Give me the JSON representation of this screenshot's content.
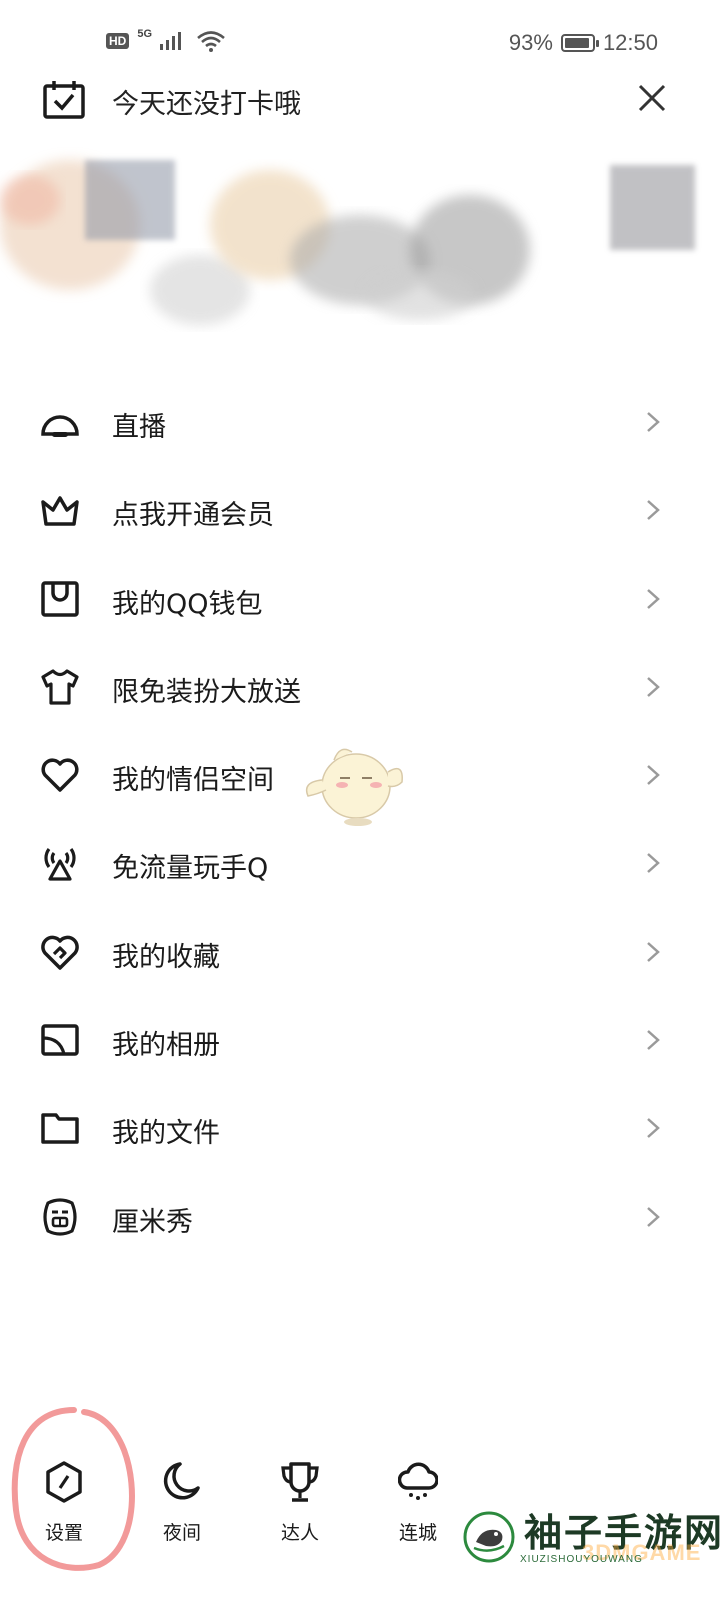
{
  "status_bar": {
    "hd": "HD",
    "network": "5G",
    "battery_text": "93%",
    "battery_level": 0.93,
    "time": "12:50",
    "icons": [
      "signal-icon",
      "wifi-icon",
      "battery-icon"
    ]
  },
  "checkin": {
    "text": "今天还没打卡哦",
    "icon": "calendar-check-icon",
    "close_icon": "close-icon"
  },
  "menu": {
    "items": [
      {
        "label": "直播",
        "icon": "live-icon"
      },
      {
        "label": "点我开通会员",
        "icon": "crown-icon"
      },
      {
        "label": "我的QQ钱包",
        "icon": "wallet-icon"
      },
      {
        "label": "限免装扮大放送",
        "icon": "tshirt-icon"
      },
      {
        "label": "我的情侣空间",
        "icon": "heart-icon"
      },
      {
        "label": "免流量玩手Q",
        "icon": "antenna-icon"
      },
      {
        "label": "我的收藏",
        "icon": "favorite-icon"
      },
      {
        "label": "我的相册",
        "icon": "album-icon"
      },
      {
        "label": "我的文件",
        "icon": "folder-icon"
      },
      {
        "label": "厘米秀",
        "icon": "cmshow-icon"
      }
    ],
    "chevron_icon": "chevron-right-icon"
  },
  "bottom_bar": {
    "items": [
      {
        "label": "设置",
        "icon": "settings-icon"
      },
      {
        "label": "夜间",
        "icon": "moon-icon"
      },
      {
        "label": "达人",
        "icon": "trophy-icon"
      },
      {
        "label": "连城",
        "icon": "cloud-icon"
      }
    ]
  },
  "watermark": {
    "title": "袖子手游网",
    "subtitle": "XIUZISHOUYOUWANG",
    "overlay": "3DMGAME"
  },
  "colors": {
    "text": "#1b1b1b",
    "chevron": "#9a9a9a",
    "highlight": "#f29a9a",
    "watermark_green": "#1d3a25"
  }
}
